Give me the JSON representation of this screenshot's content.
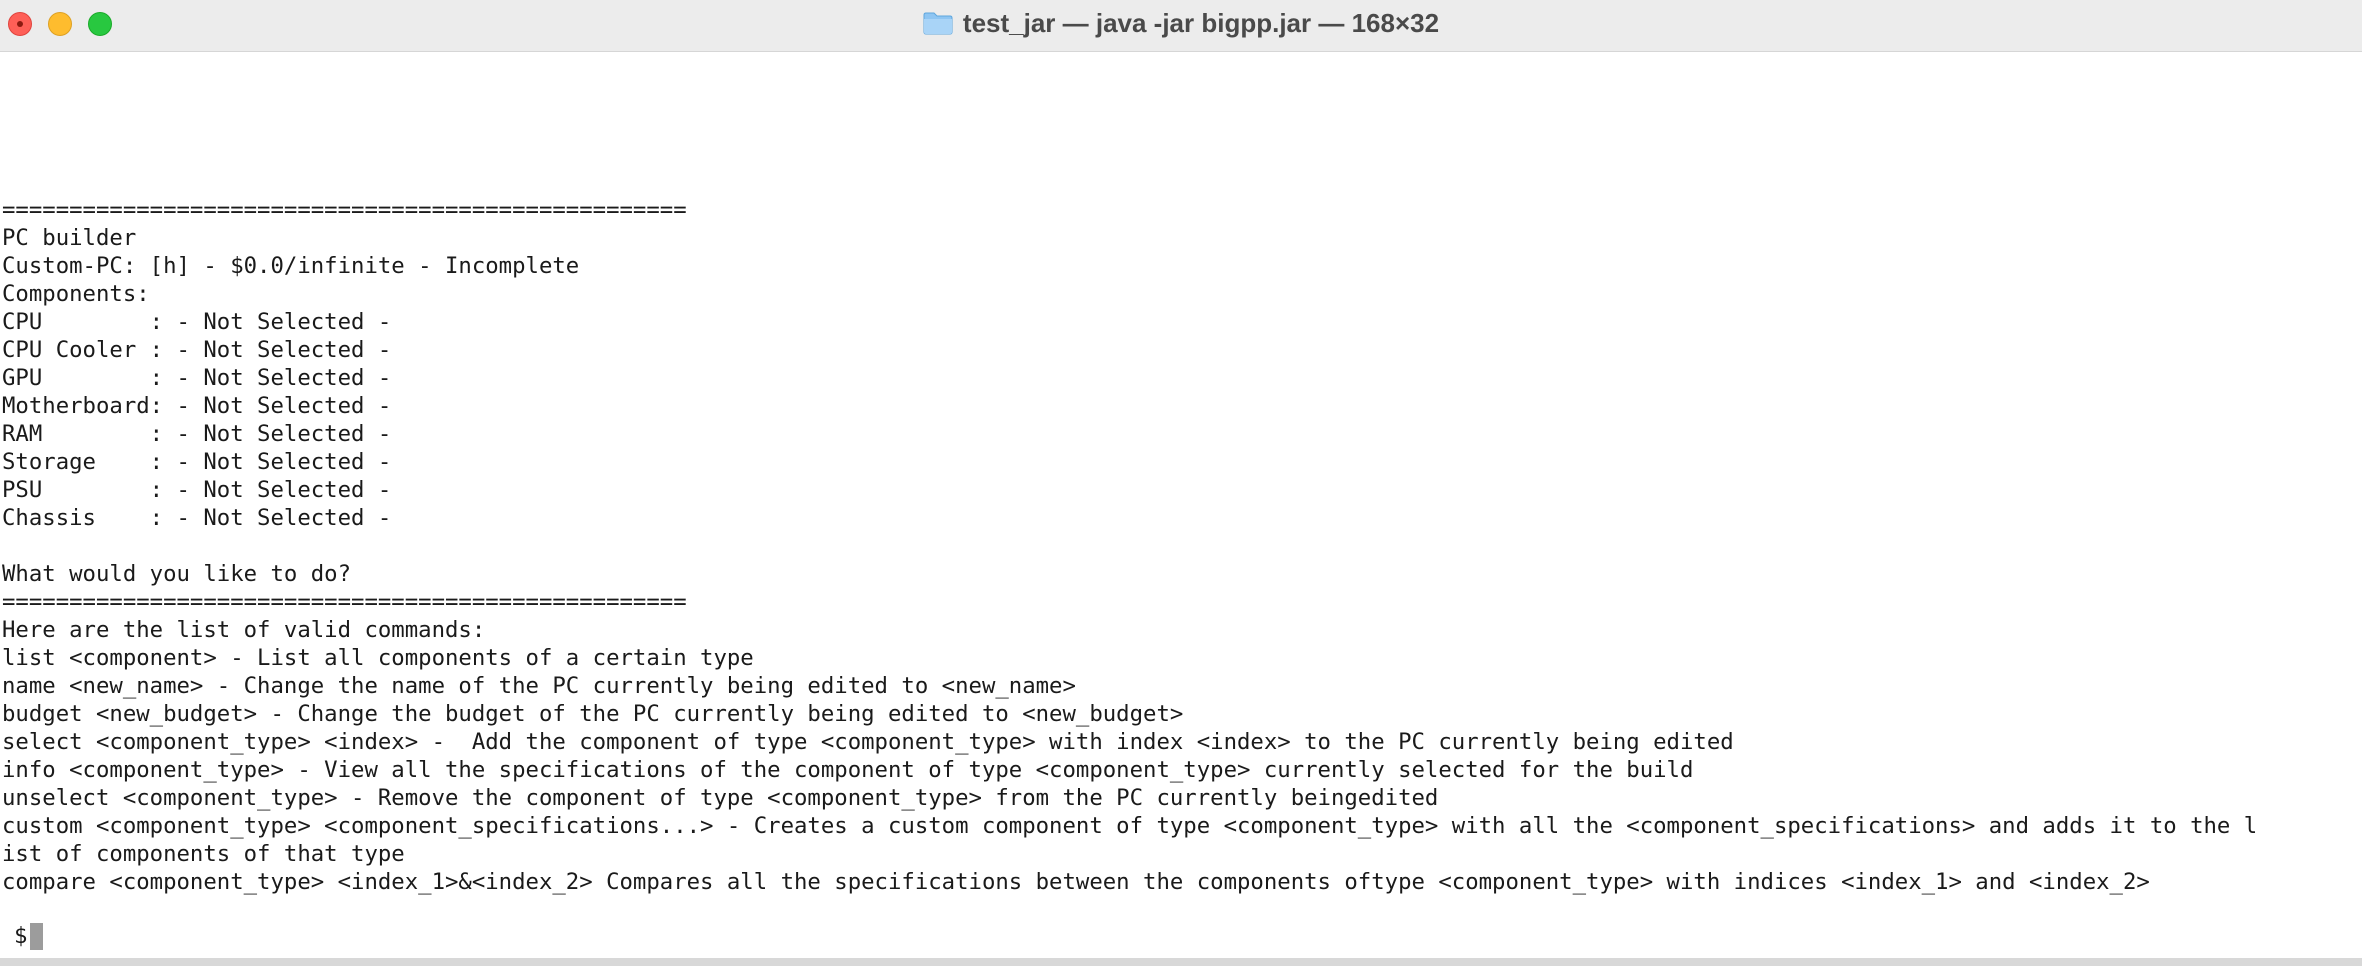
{
  "window": {
    "title": "test_jar — java -jar bigpp.jar — 168×32",
    "folder_icon": "folder-icon"
  },
  "terminal": {
    "lines": [
      "===================================================",
      "PC builder",
      "Custom-PC: [h] - $0.0/infinite - Incomplete",
      "Components:",
      "CPU        : - Not Selected -",
      "CPU Cooler : - Not Selected -",
      "GPU        : - Not Selected -",
      "Motherboard: - Not Selected -",
      "RAM        : - Not Selected -",
      "Storage    : - Not Selected -",
      "PSU        : - Not Selected -",
      "Chassis    : - Not Selected -",
      "",
      "What would you like to do?",
      "===================================================",
      "Here are the list of valid commands:",
      "list <component> - List all components of a certain type",
      "name <new_name> - Change the name of the PC currently being edited to <new_name>",
      "budget <new_budget> - Change the budget of the PC currently being edited to <new_budget>",
      "select <component_type> <index> -  Add the component of type <component_type> with index <index> to the PC currently being edited",
      "info <component_type> - View all the specifications of the component of type <component_type> currently selected for the build",
      "unselect <component_type> - Remove the component of type <component_type> from the PC currently beingedited",
      "custom <component_type> <component_specifications...> - Creates a custom component of type <component_type> with all the <component_specifications> and adds it to the l",
      "ist of components of that type",
      "compare <component_type> <index_1>&<index_2> Compares all the specifications between the components oftype <component_type> with indices <index_1> and <index_2>"
    ],
    "prompt": "$"
  },
  "colors": {
    "close": "#fe5f57",
    "minimize": "#febc2e",
    "zoom": "#28c840",
    "cursor": "#9c9c9c"
  }
}
